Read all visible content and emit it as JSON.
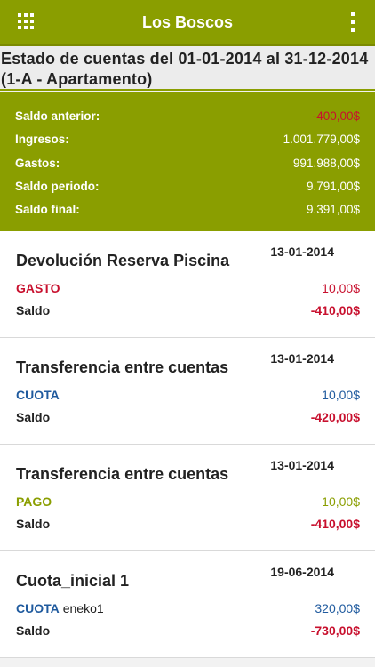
{
  "appbar": {
    "title": "Los Boscos",
    "menu_icon": "grid-icon",
    "overflow_icon": "overflow-menu-icon"
  },
  "header": {
    "line1": "Estado de cuentas del 01-01-2014 al 31-12-2014",
    "line2": "(1-A - Apartamento)"
  },
  "summary": [
    {
      "label": "Saldo anterior:",
      "value": "-400,00$",
      "negative": true
    },
    {
      "label": "Ingresos:",
      "value": "1.001.779,00$",
      "negative": false
    },
    {
      "label": "Gastos:",
      "value": "991.988,00$",
      "negative": false
    },
    {
      "label": "Saldo periodo:",
      "value": "9.791,00$",
      "negative": false
    },
    {
      "label": "Saldo final:",
      "value": "9.391,00$",
      "negative": false
    }
  ],
  "transactions": [
    {
      "title": "Devolución Reserva Piscina",
      "date": "13-01-2014",
      "type": "GASTO",
      "type_color": "#c8102e",
      "sub": "",
      "amount": "10,00$",
      "saldo_label": "Saldo",
      "saldo": "-410,00$"
    },
    {
      "title": "Transferencia entre cuentas",
      "date": "13-01-2014",
      "type": "CUOTA",
      "type_color": "#1f5a9e",
      "sub": "",
      "amount": "10,00$",
      "saldo_label": "Saldo",
      "saldo": "-420,00$"
    },
    {
      "title": "Transferencia entre cuentas",
      "date": "13-01-2014",
      "type": "PAGO",
      "type_color": "#8a9e00",
      "sub": "",
      "amount": "10,00$",
      "saldo_label": "Saldo",
      "saldo": "-410,00$"
    },
    {
      "title": "Cuota_inicial 1",
      "date": "19-06-2014",
      "type": "CUOTA",
      "type_color": "#1f5a9e",
      "sub": "eneko1",
      "amount": "320,00$",
      "saldo_label": "Saldo",
      "saldo": "-730,00$"
    }
  ],
  "colors": {
    "accent": "#8a9e00",
    "negative": "#c8102e",
    "cuota": "#1f5a9e"
  }
}
